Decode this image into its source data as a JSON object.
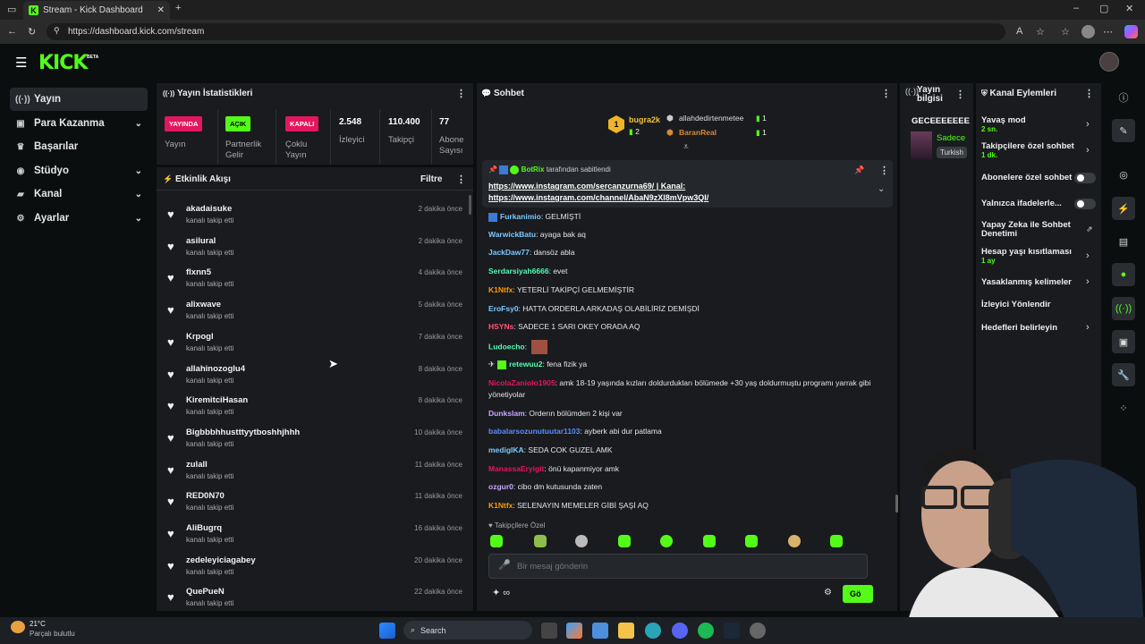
{
  "browser": {
    "tab_title": "Stream - Kick Dashboard",
    "url": "https://dashboard.kick.com/stream"
  },
  "logo": {
    "text": "KICK",
    "beta": "BETA"
  },
  "sidebar": {
    "items": [
      {
        "label": "Yayın",
        "icon": "broadcast-icon"
      },
      {
        "label": "Para Kazanma",
        "icon": "money-icon"
      },
      {
        "label": "Başarılar",
        "icon": "trophy-icon"
      },
      {
        "label": "Stüdyo",
        "icon": "studio-icon"
      },
      {
        "label": "Kanal",
        "icon": "channel-icon"
      },
      {
        "label": "Ayarlar",
        "icon": "gear-icon"
      }
    ]
  },
  "stats": {
    "title": "Yayın İstatistikleri",
    "items": [
      {
        "badge": "YAYINDA",
        "label": "Yayın",
        "color": "#e3175d"
      },
      {
        "badge": "AÇIK",
        "label": "Partnerlik Gelir",
        "color": "#53fc18"
      },
      {
        "badge": "KAPALI",
        "label": "Çoklu Yayın",
        "color": "#e3175d"
      },
      {
        "value": "2.548",
        "label": "İzleyici"
      },
      {
        "value": "110.400",
        "label": "Takipçi"
      },
      {
        "value": "77",
        "label": "Abone Sayısı"
      }
    ]
  },
  "feed": {
    "title": "Etkinlik Akışı",
    "filter": "Filtre",
    "items": [
      {
        "name": "akadaisuke",
        "sub": "kanalı takip etti",
        "time": "2 dakika önce"
      },
      {
        "name": "asilural",
        "sub": "kanalı takip etti",
        "time": "2 dakika önce"
      },
      {
        "name": "flxnn5",
        "sub": "kanalı takip etti",
        "time": "4 dakika önce"
      },
      {
        "name": "alixwave",
        "sub": "kanalı takip etti",
        "time": "5 dakika önce"
      },
      {
        "name": "Krpogl",
        "sub": "kanalı takip etti",
        "time": "7 dakika önce"
      },
      {
        "name": "allahinozoglu4",
        "sub": "kanalı takip etti",
        "time": "8 dakika önce"
      },
      {
        "name": "KiremitciHasan",
        "sub": "kanalı takip etti",
        "time": "8 dakika önce"
      },
      {
        "name": "Bigbbbhhustttyytboshhjhhh",
        "sub": "kanalı takip etti",
        "time": "10 dakika önce"
      },
      {
        "name": "zulall",
        "sub": "kanalı takip etti",
        "time": "11 dakika önce"
      },
      {
        "name": "RED0N70",
        "sub": "kanalı takip etti",
        "time": "11 dakika önce"
      },
      {
        "name": "AliBugrq",
        "sub": "kanalı takip etti",
        "time": "16 dakika önce"
      },
      {
        "name": "zedeleyiciagabey",
        "sub": "kanalı takip etti",
        "time": "20 dakika önce"
      },
      {
        "name": "QuePueN",
        "sub": "kanalı takip etti",
        "time": "22 dakika önce"
      }
    ]
  },
  "chat": {
    "title": "Sohbet",
    "leaders": [
      {
        "name": "bugra2k",
        "count": "2"
      },
      {
        "name": "allahdedirtenmetee",
        "count": "1"
      },
      {
        "name": "BaranReal",
        "count": "1"
      }
    ],
    "pinned": {
      "by": "BotRix",
      "note": "tarafından sabitlendi",
      "line1": "https://www.instagram.com/sercanzurna69/ | Kanal:",
      "line2": "https://www.instagram.com/channel/AbaN9zXl8mVpw3QI/"
    },
    "messages": [
      {
        "user": "Furkanimio",
        "text": "GELMİŞTİ",
        "color": "#7ec8ff"
      },
      {
        "user": "WarwickBatu",
        "text": "ayaga bak aq",
        "color": "#7ec8ff"
      },
      {
        "user": "JackDaw77",
        "text": "dansöz abla",
        "color": "#7ec8ff"
      },
      {
        "user": "Serdarsiyah6666",
        "text": "evet",
        "color": "#53fcb0"
      },
      {
        "user": "K1Ntfx",
        "text": "YETERLİ TAKİPÇİ GELMEMİŞTİR",
        "color": "#ff9900"
      },
      {
        "user": "EroFsy0",
        "text": "HATTA ORDERLA ARKADAŞ OLABİLİRİZ DEMİŞDİ",
        "color": "#7ec8ff"
      },
      {
        "user": "HSYNs",
        "text": "SADECE 1 SARI OKEY ORADA AQ",
        "color": "#ff5577"
      },
      {
        "user": "Ludoecho",
        "text": "",
        "color": "#53fcb0"
      },
      {
        "user": "retewuu2",
        "text": "fena fizik ya",
        "color": "#53fcb0"
      },
      {
        "user": "NicolaZaniolo1905",
        "text": "amk 18-19 yaşında kızları doldurdukları bölümede +30 yaş doldurmuştu programı yarrak gibi yönetiyolar",
        "color": "#e3175d"
      },
      {
        "user": "Dunkslam",
        "text": "Orderın bölümden 2 kişi var",
        "color": "#c8a6ff"
      },
      {
        "user": "babalarsozunutuutar1103",
        "text": "ayberk abi dur patlama",
        "color": "#5b8cff"
      },
      {
        "user": "medigIKA",
        "text": "SEDA COK GUZEL AMK",
        "color": "#7ec8ff"
      },
      {
        "user": "ManassaEryigit",
        "text": "önü kapanmiyor amk",
        "color": "#e3175d"
      },
      {
        "user": "ozgur0",
        "text": "cibo dm kutusunda zaten",
        "color": "#c8a6ff"
      },
      {
        "user": "K1Ntfx",
        "text": "SELENAYIN MEMELER GİBİ ŞAŞİ AQ",
        "color": "#ff9900"
      }
    ],
    "followers_only": "Takipçilere Özel",
    "placeholder": "Bir mesaj gönderin",
    "send": "Gö"
  },
  "stream_info": {
    "title": "Yayın bilgisi",
    "stream_title": "GECEEEEEEE",
    "category": "Sadece",
    "tag": "Turkish"
  },
  "channel_actions": {
    "title": "Kanal Eylemleri",
    "items": [
      {
        "label": "Yavaş mod",
        "sub": "2 sn."
      },
      {
        "label": "Takipçilere özel sohbet",
        "sub": "1 dk."
      },
      {
        "label": "Abonelere özel sohbet",
        "sub": ""
      },
      {
        "label": "Yalnızca ifadelerle...",
        "sub": ""
      },
      {
        "label": "Yapay Zeka ile Sohbet Denetimi",
        "sub": ""
      },
      {
        "label": "Hesap yaşı kısıtlaması",
        "sub": "1 ay"
      },
      {
        "label": "Yasaklanmış kelimeler",
        "sub": ""
      },
      {
        "label": "İzleyici Yönlendir",
        "sub": ""
      },
      {
        "label": "Hedefleri belirleyin",
        "sub": ""
      }
    ]
  },
  "taskbar": {
    "weather_temp": "21°C",
    "weather_desc": "Parçalı bulutlu",
    "search": "Search"
  }
}
